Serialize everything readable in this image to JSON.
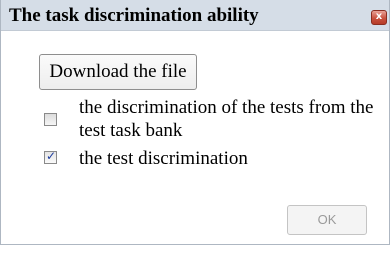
{
  "dialog": {
    "title": "The task discrimination ability",
    "close_glyph": "x",
    "download_label": "Download the file",
    "options": [
      {
        "label": "the discrimination of the tests from the test task bank",
        "checked": false
      },
      {
        "label": "the test discrimination",
        "checked": true
      }
    ],
    "check_glyph": "✓",
    "ok_label": "OK",
    "ok_enabled": false
  },
  "colors": {
    "titlebar": "#d5dde7",
    "close_button": "#c9523f",
    "checkmark": "#1d3c9e",
    "disabled_text": "#9a9a9a"
  }
}
